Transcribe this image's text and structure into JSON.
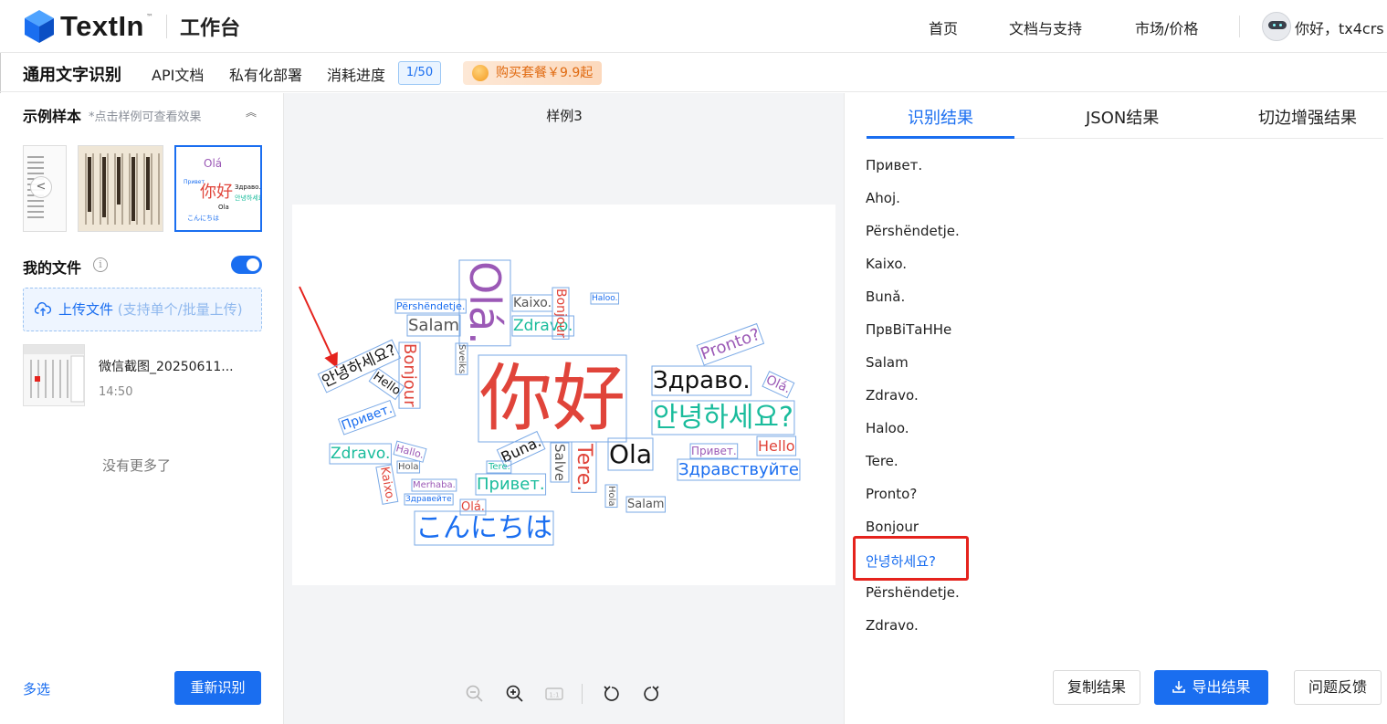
{
  "header": {
    "logo_text_main": "TextIn",
    "workbench": "工作台",
    "nav": [
      "首页",
      "文档与支持",
      "市场/价格"
    ],
    "user_greeting": "你好，tx4crs"
  },
  "subheader": {
    "title": "通用文字识别",
    "links": [
      "API文档",
      "私有化部署",
      "消耗进度"
    ],
    "quota": "1/50",
    "promo": "购买套餐￥9.9起"
  },
  "left": {
    "samples_title": "示例样本",
    "samples_hint": "*点击样例可查看效果",
    "my_files_title": "我的文件",
    "upload_label": "上传文件",
    "upload_hint": "(支持单个/批量上传)",
    "file": {
      "name": "微信截图_20250611...",
      "time": "14:50"
    },
    "no_more": "没有更多了",
    "multi_select": "多选",
    "rerun": "重新识别"
  },
  "center": {
    "sample_title": "样例3",
    "wordcloud": [
      {
        "t": "你好",
        "c": "#e0443a"
      },
      {
        "t": "Olá.",
        "c": "#9b59b6"
      },
      {
        "t": "Здраво.",
        "c": "#111111"
      },
      {
        "t": "안녕하세요?",
        "c": "#1abc9c"
      },
      {
        "t": "Ola",
        "c": "#111111"
      },
      {
        "t": "Здравствуйте",
        "c": "#1a6ef0"
      },
      {
        "t": "こんにちは",
        "c": "#1a6ef0"
      },
      {
        "t": "Bonjour",
        "c": "#e0443a"
      },
      {
        "t": "Salam",
        "c": "#555555"
      },
      {
        "t": "Zdravo.",
        "c": "#1abc9c"
      },
      {
        "t": "Kaixo.",
        "c": "#555555"
      },
      {
        "t": "Përshëndetje.",
        "c": "#1a6ef0"
      },
      {
        "t": "Привет.",
        "c": "#1abc9c"
      },
      {
        "t": "Hello",
        "c": "#e0443a"
      },
      {
        "t": "Tere.",
        "c": "#e0443a"
      },
      {
        "t": "Buna.",
        "c": "#111111"
      },
      {
        "t": "Salve",
        "c": "#555555"
      },
      {
        "t": "Pronto?",
        "c": "#9b59b6"
      },
      {
        "t": "Привет.",
        "c": "#9b59b6"
      },
      {
        "t": "Hello",
        "c": "#111111"
      },
      {
        "t": "Bonjour",
        "c": "#e0443a"
      },
      {
        "t": "안녕하세요?",
        "c": "#111111"
      },
      {
        "t": "Olá.",
        "c": "#9b59b6"
      },
      {
        "t": "Привет.",
        "c": "#1a6ef0"
      },
      {
        "t": "Zdravo.",
        "c": "#1abc9c"
      },
      {
        "t": "Kaixo.",
        "c": "#e0443a"
      },
      {
        "t": "Hallo.",
        "c": "#9b59b6"
      },
      {
        "t": "Hola",
        "c": "#555555"
      },
      {
        "t": "Salam",
        "c": "#555555"
      },
      {
        "t": "Olá.",
        "c": "#e0443a"
      },
      {
        "t": "Haloo.",
        "c": "#1a6ef0"
      },
      {
        "t": "Tere.",
        "c": "#1abc9c"
      },
      {
        "t": "Merhaba.",
        "c": "#9b59b6"
      },
      {
        "t": "Sveiks",
        "c": "#555555"
      },
      {
        "t": "Hola",
        "c": "#555555"
      },
      {
        "t": "Здравейте",
        "c": "#1a6ef0"
      }
    ]
  },
  "right": {
    "tabs": [
      "识别结果",
      "JSON结果",
      "切边增强结果"
    ],
    "results": [
      "Привет.",
      "Ahoj.",
      "Përshëndetje.",
      "Kaixo.",
      "Bunǎ.",
      "ПрвВiТаННе",
      "Salam",
      "Zdravo.",
      "Haloo.",
      "Tere.",
      "Pronto?",
      "Bonjour",
      "안녕하세요?",
      "Përshëndetje.",
      "Zdravo."
    ],
    "buttons": {
      "copy": "复制结果",
      "export": "导出结果",
      "feedback": "问题反馈"
    }
  },
  "colors": {
    "accent": "#1a6ef0",
    "highlight_box": "#e5231d"
  }
}
